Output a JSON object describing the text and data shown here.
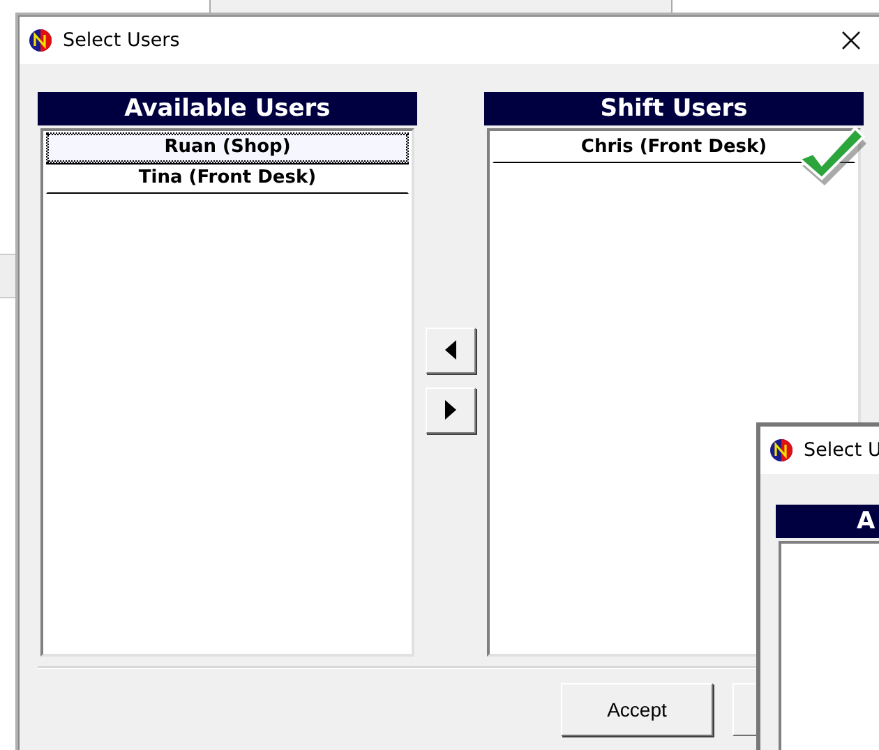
{
  "dialog": {
    "title": "Select Users",
    "available": {
      "heading": "Available Users",
      "items": [
        {
          "label": "Ruan (Shop)",
          "selected": true
        },
        {
          "label": "Tina (Front Desk)",
          "selected": false
        }
      ]
    },
    "shift": {
      "heading": "Shift Users",
      "items": [
        {
          "label": "Chris (Front Desk)",
          "selected": false
        }
      ]
    },
    "buttons": [
      {
        "kind": "text",
        "label": "Accept"
      },
      {
        "kind": "blank"
      }
    ]
  },
  "second_dialog": {
    "title": "Select U",
    "heading": "A"
  }
}
